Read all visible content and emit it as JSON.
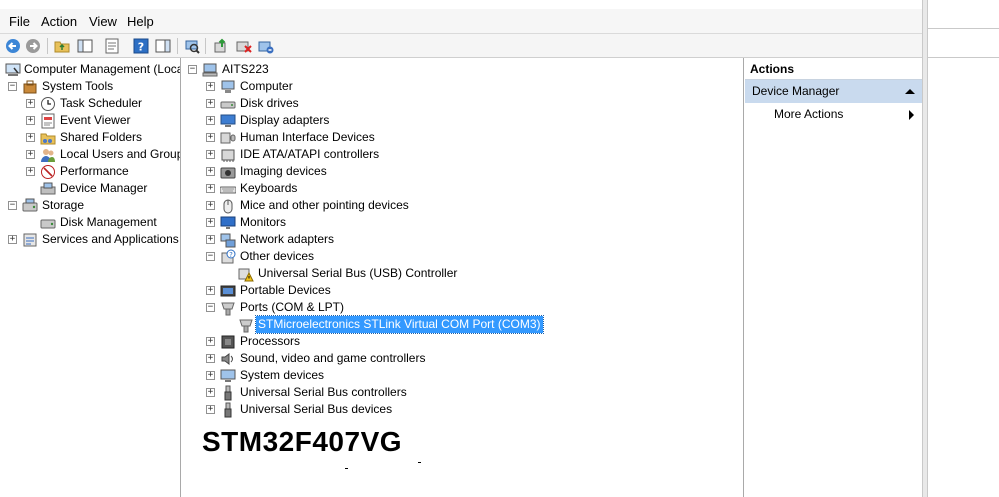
{
  "menu": [
    "File",
    "Action",
    "View",
    "Help"
  ],
  "toolbar_icons": [
    "back-icon",
    "forward-icon",
    "up-folder-icon",
    "show-hide-tree-icon",
    "properties-icon",
    "help-icon",
    "show-hide-action-pane-icon",
    "scan-hardware-icon",
    "update-driver-icon",
    "disable-device-icon",
    "uninstall-device-icon"
  ],
  "left_tree": {
    "root": "Computer Management (Local",
    "system_tools": "System Tools",
    "task_scheduler": "Task Scheduler",
    "event_viewer": "Event Viewer",
    "shared_folders": "Shared Folders",
    "local_users": "Local Users and Groups",
    "performance": "Performance",
    "device_manager": "Device Manager",
    "storage": "Storage",
    "disk_management": "Disk Management",
    "services": "Services and Applications"
  },
  "device_tree": {
    "root": "AITS223",
    "items": [
      "Computer",
      "Disk drives",
      "Display adapters",
      "Human Interface Devices",
      "IDE ATA/ATAPI controllers",
      "Imaging devices",
      "Keyboards",
      "Mice and other pointing devices",
      "Monitors",
      "Network adapters",
      "Other devices",
      "Universal Serial Bus (USB) Controller",
      "Portable Devices",
      "Ports (COM & LPT)",
      "STMicroelectronics STLink Virtual COM Port (COM3)",
      "Processors",
      "Sound, video and game controllers",
      "System devices",
      "Universal Serial Bus controllers",
      "Universal Serial Bus devices"
    ]
  },
  "actions": {
    "header": "Actions",
    "section": "Device Manager",
    "more": "More Actions"
  },
  "overlay_title": "STM32F407VG"
}
